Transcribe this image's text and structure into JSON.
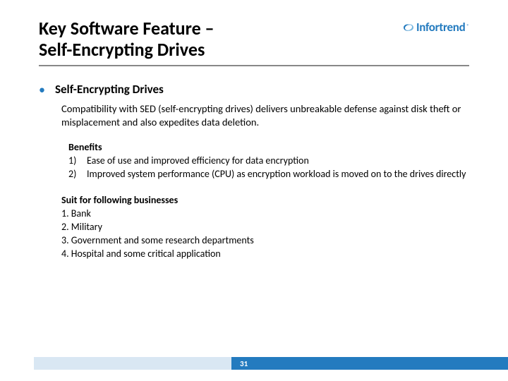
{
  "logo": {
    "brand": "Infortrend"
  },
  "title_line1": "Key Software Feature –",
  "title_line2": "Self-Encrypting Drives",
  "section": {
    "heading": "Self-Encrypting Drives",
    "description": "Compatibility with SED (self-encrypting drives) delivers unbreakable defense against disk theft or misplacement and also expedites data deletion."
  },
  "benefits": {
    "heading": "Benefits",
    "items": [
      "Ease of use and improved  efficiency for data encryption",
      "Improved system performance (CPU) as encryption workload is moved on to the drives directly"
    ]
  },
  "suit": {
    "heading": "Suit for following businesses",
    "items": [
      "Bank",
      "Military",
      "Government and some research departments",
      "Hospital and some critical application"
    ]
  },
  "page_number": "31"
}
